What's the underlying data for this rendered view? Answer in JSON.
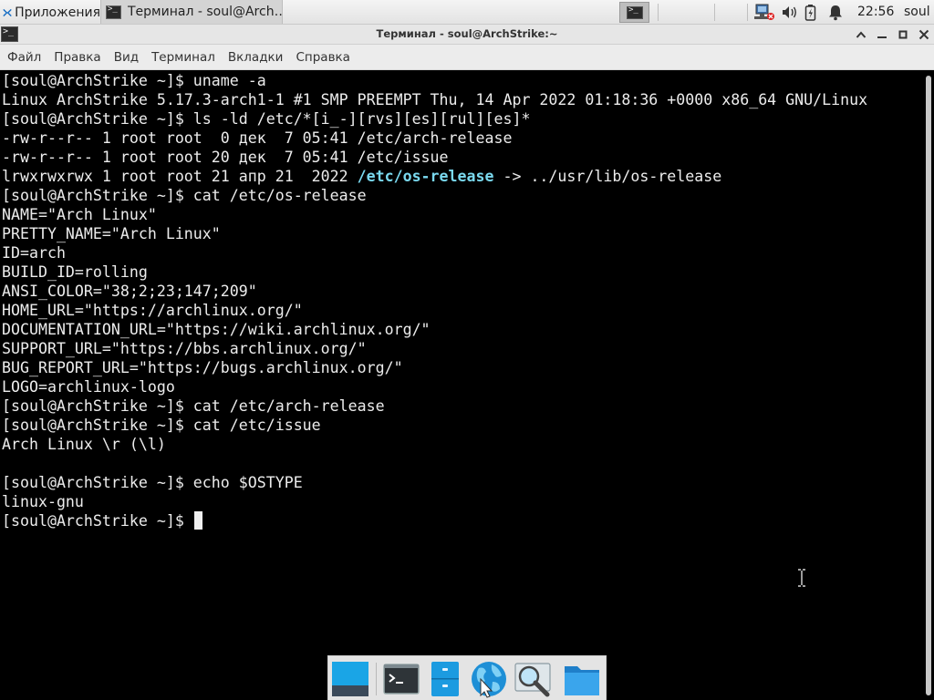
{
  "panel": {
    "apps_menu_label": "Приложения",
    "task_title": "Терминал - soul@Arch…",
    "clock": "22:56",
    "user": "soul"
  },
  "window": {
    "title": "Терминал - soul@ArchStrike:~"
  },
  "menubar": {
    "items": [
      "Файл",
      "Правка",
      "Вид",
      "Терминал",
      "Вкладки",
      "Справка"
    ]
  },
  "terminal": {
    "lines": [
      "[soul@ArchStrike ~]$ uname -a",
      "Linux ArchStrike 5.17.3-arch1-1 #1 SMP PREEMPT Thu, 14 Apr 2022 01:18:36 +0000 x86_64 GNU/Linux",
      "[soul@ArchStrike ~]$ ls -ld /etc/*[i_-][rvs][es][rul][es]*",
      "-rw-r--r-- 1 root root  0 дек  7 05:41 /etc/arch-release",
      "-rw-r--r-- 1 root root 20 дек  7 05:41 /etc/issue",
      "",
      "[soul@ArchStrike ~]$ cat /etc/os-release",
      "NAME=\"Arch Linux\"",
      "PRETTY_NAME=\"Arch Linux\"",
      "ID=arch",
      "BUILD_ID=rolling",
      "ANSI_COLOR=\"38;2;23;147;209\"",
      "HOME_URL=\"https://archlinux.org/\"",
      "DOCUMENTATION_URL=\"https://wiki.archlinux.org/\"",
      "SUPPORT_URL=\"https://bbs.archlinux.org/\"",
      "BUG_REPORT_URL=\"https://bugs.archlinux.org/\"",
      "LOGO=archlinux-logo",
      "[soul@ArchStrike ~]$ cat /etc/arch-release",
      "[soul@ArchStrike ~]$ cat /etc/issue",
      "Arch Linux \\r (\\l)",
      "",
      "[soul@ArchStrike ~]$ echo $OSTYPE",
      "linux-gnu"
    ],
    "symlink_line": {
      "prefix": "lrwxrwxrwx 1 root root 21 апр 21  2022 ",
      "link": "/etc/os-release",
      "suffix": " -> ../usr/lib/os-release"
    },
    "prompt": "[soul@ArchStrike ~]$ ",
    "link_color": "#7ad9ef"
  },
  "icons": {
    "panel": [
      "xfce-mouse-icon",
      "terminal-icon",
      "network-icon",
      "volume-icon",
      "battery-icon",
      "notification-bell-icon"
    ],
    "dock": [
      "show-desktop-icon",
      "terminal-icon",
      "file-manager-icon",
      "web-browser-icon",
      "app-finder-icon",
      "folder-icon"
    ]
  }
}
